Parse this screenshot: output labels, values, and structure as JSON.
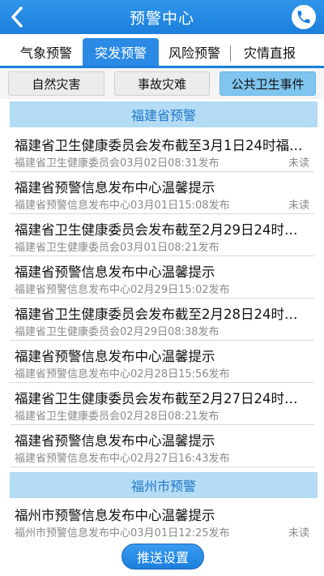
{
  "header": {
    "title": "预警中心"
  },
  "tabs": [
    {
      "label": "气象预警"
    },
    {
      "label": "突发预警"
    },
    {
      "label": "风险预警"
    },
    {
      "label": "灾情直报"
    }
  ],
  "subtabs": [
    {
      "label": "自然灾害"
    },
    {
      "label": "事故灾难"
    },
    {
      "label": "公共卫生事件"
    }
  ],
  "sections": [
    {
      "header": "福建省预警",
      "items": [
        {
          "title": "福建省卫生健康委员会发布截至3月1日24时福建省新型冠状病毒肺炎疫情情况",
          "meta": "福建省卫生健康委员会03月02日08:31发布",
          "status": "未读"
        },
        {
          "title": "福建省预警信息发布中心温馨提示",
          "meta": "福建省预警信息发布中心03月01日15:08发布",
          "status": "未读"
        },
        {
          "title": "福建省卫生健康委员会发布截至2月29日24时福建省新型冠状病毒肺炎疫情情况",
          "meta": "福建省卫生健康委员会03月01日08:21发布",
          "status": ""
        },
        {
          "title": "福建省预警信息发布中心温馨提示",
          "meta": "福建省预警信息发布中心02月29日15:02发布",
          "status": ""
        },
        {
          "title": "福建省卫生健康委员会发布截至2月28日24时福建省新型冠状病毒肺炎疫情情况",
          "meta": "福建省卫生健康委员会02月29日08:38发布",
          "status": ""
        },
        {
          "title": "福建省预警信息发布中心温馨提示",
          "meta": "福建省预警信息发布中心02月28日15:56发布",
          "status": ""
        },
        {
          "title": "福建省卫生健康委员会发布截至2月27日24时福建省新型冠状病毒肺炎疫情情况",
          "meta": "福建省卫生健康委员会02月28日08:21发布",
          "status": ""
        },
        {
          "title": "福建省预警信息发布中心温馨提示",
          "meta": "福建省预警信息发布中心02月27日16:43发布",
          "status": ""
        }
      ]
    },
    {
      "header": "福州市预警",
      "items": [
        {
          "title": "福州市预警信息发布中心温馨提示",
          "meta": "福州市预警信息发布中心03月01日12:25发布",
          "status": "未读"
        }
      ]
    }
  ],
  "push_button": {
    "label": "推送设置"
  },
  "colors": {
    "primary": "#1b7fdc",
    "section_bg": "#b4dcf5",
    "section_text": "#2179c8",
    "subtab_active": "#7fc5ef"
  }
}
